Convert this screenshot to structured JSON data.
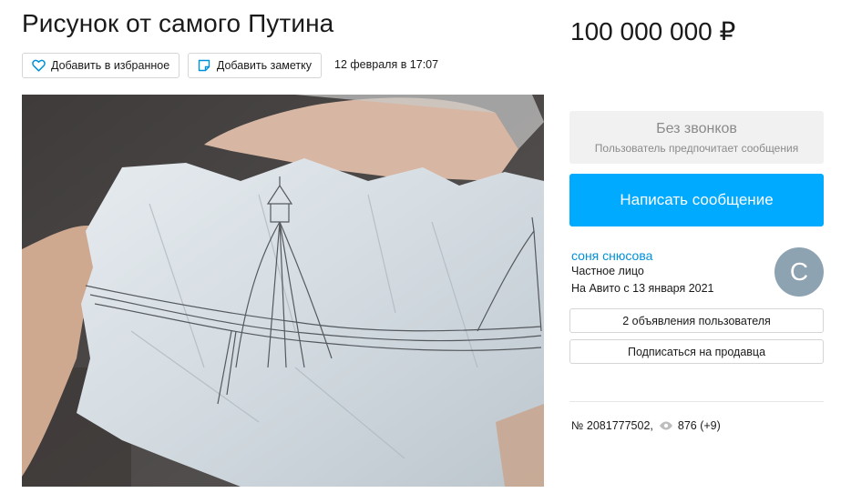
{
  "listing": {
    "title": "Рисунок от самого Путина",
    "price": "100 000 000 ₽",
    "date": "12 февраля в 17:07",
    "number": "№ 2081777502,",
    "views": "876 (+9)"
  },
  "actions": {
    "favorite_label": "Добавить в избранное",
    "note_label": "Добавить заметку"
  },
  "contact": {
    "no_calls_title": "Без звонков",
    "no_calls_subtitle": "Пользователь предпочитает сообщения",
    "write_label": "Написать сообщение"
  },
  "seller": {
    "name": "соня снюсова",
    "type": "Частное лицо",
    "since": "На Авито с 13 января 2021",
    "avatar_letter": "С",
    "ads_label": "2 объявления пользователя",
    "subscribe_label": "Подписаться на продавца"
  },
  "icons": {
    "favorite": "heart-icon",
    "note": "note-icon",
    "views": "eye-icon"
  },
  "colors": {
    "accent": "#00aaff",
    "link": "#0091d9",
    "avatar": "#8ea3b2",
    "muted_bg": "#f1f1f1"
  }
}
